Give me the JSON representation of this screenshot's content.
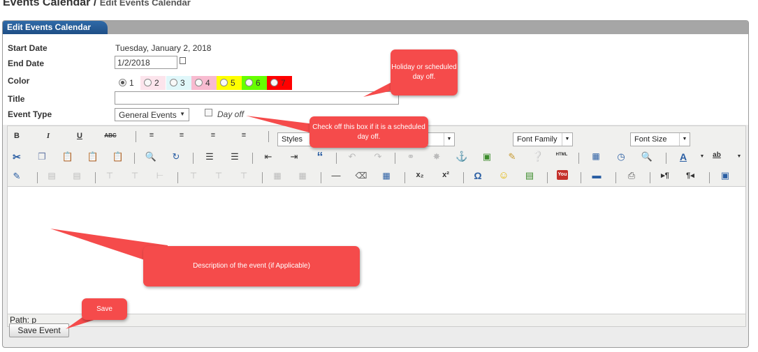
{
  "breadcrumb": {
    "title": "Events Calendar",
    "separator": "/",
    "current": "Edit Events Calendar"
  },
  "panel": {
    "tab_label": "Edit Events Calendar"
  },
  "form": {
    "start_date": {
      "label": "Start Date",
      "value": "Tuesday, January 2, 2018"
    },
    "end_date": {
      "label": "End Date",
      "value": "1/2/2018"
    },
    "color": {
      "label": "Color",
      "selected": "1",
      "options": [
        {
          "value": "1",
          "bg": "#ffffff",
          "fg": "#333333"
        },
        {
          "value": "2",
          "bg": "#fce4ec",
          "fg": "#333333"
        },
        {
          "value": "3",
          "bg": "#e0f7fa",
          "fg": "#333333"
        },
        {
          "value": "4",
          "bg": "#f8bbd0",
          "fg": "#333333"
        },
        {
          "value": "5",
          "bg": "#ffff00",
          "fg": "#333333"
        },
        {
          "value": "6",
          "bg": "#66ff00",
          "fg": "#333333"
        },
        {
          "value": "7",
          "bg": "#ff0000",
          "fg": "#333333"
        }
      ]
    },
    "title": {
      "label": "Title",
      "value": ""
    },
    "event_type": {
      "label": "Event Type",
      "selected": "General Events",
      "day_off_label": "Day off"
    }
  },
  "editor": {
    "styles_select": "Styles",
    "font_family_select": "Font Family",
    "font_size_select": "Font Size",
    "path_label": "Path: p"
  },
  "save_button": "Save Event",
  "callouts": {
    "holiday": "Holiday or scheduled day off.",
    "checkoff": "Check off this box if it is a scheduled day off.",
    "description": "Description of the event (if Applicable)",
    "save": "Save"
  },
  "colors": {
    "tab": "#2f6aa8",
    "callout": "#f54b4b",
    "panel_header": "#a6a6a6"
  }
}
